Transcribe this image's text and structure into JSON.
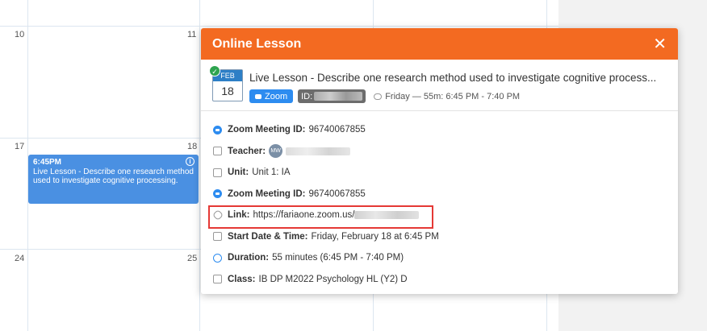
{
  "calendar": {
    "day_numbers": {
      "d10": "10",
      "d11": "11",
      "d17": "17",
      "d18": "18",
      "d24": "24",
      "d25": "25"
    },
    "event": {
      "time": "6:45PM",
      "title": "Live Lesson - Describe one research method used to investigate cognitive processing.",
      "info_glyph": "i",
      "color": "#4a90e2"
    }
  },
  "popup": {
    "title": "Online Lesson",
    "close_glyph": "✕",
    "header_color": "#f36a21",
    "date_badge": {
      "month": "FEB",
      "day": "18"
    },
    "summary_title": "Live Lesson - Describe one research method used to investigate cognitive process...",
    "tags": {
      "zoom": "Zoom",
      "id_label": "ID:"
    },
    "time_text": "Friday — 55m: 6:45 PM - 7:40 PM",
    "details": {
      "zoom_id_1": {
        "label": "Zoom Meeting ID:",
        "value": "96740067855"
      },
      "teacher": {
        "label": "Teacher:",
        "avatar": "MW"
      },
      "unit": {
        "label": "Unit:",
        "value": "Unit 1: IA"
      },
      "zoom_id_2": {
        "label": "Zoom Meeting ID:",
        "value": "96740067855"
      },
      "link": {
        "label": "Link:",
        "value": "https://fariaone.zoom.us/"
      },
      "start": {
        "label": "Start Date & Time:",
        "value": "Friday, February 18 at 6:45 PM"
      },
      "duration": {
        "label": "Duration:",
        "value": "55 minutes (6:45 PM - 7:40 PM)"
      },
      "class": {
        "label": "Class:",
        "value": "IB DP M2022 Psychology HL (Y2) D"
      }
    }
  }
}
